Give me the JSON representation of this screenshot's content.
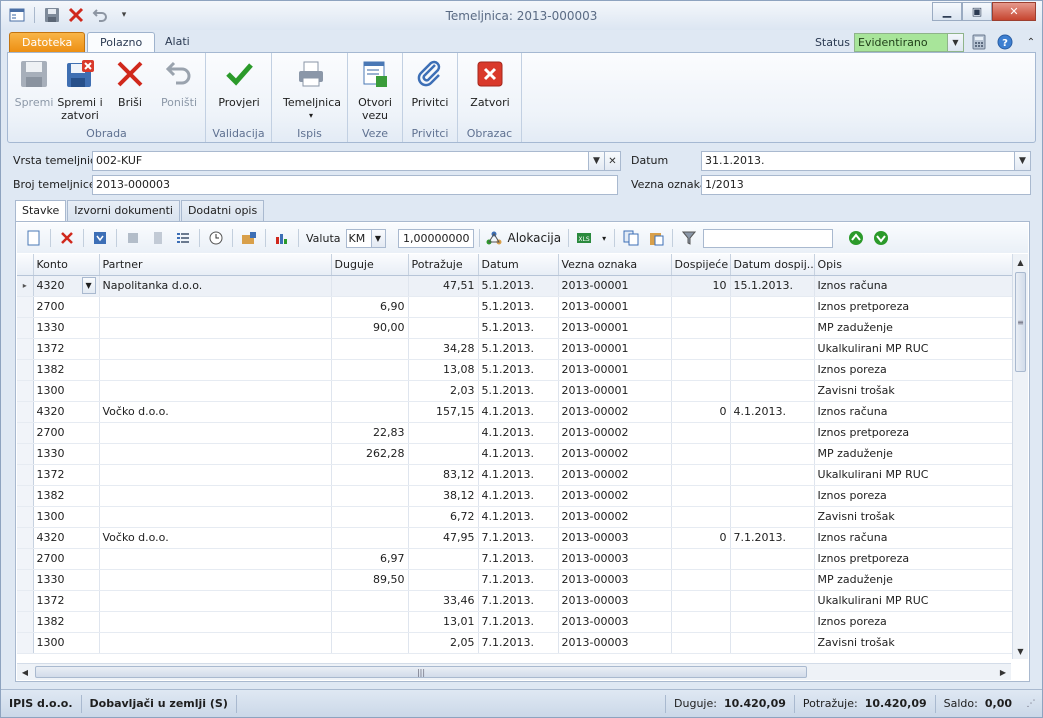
{
  "window": {
    "title": "Temeljnica: 2013-000003"
  },
  "ribbon_tabs": {
    "file": "Datoteka",
    "home": "Polazno",
    "tools": "Alati"
  },
  "status": {
    "label": "Status",
    "value": "Evidentirano"
  },
  "ribbon": {
    "groups": {
      "obrada": "Obrada",
      "validacija": "Validacija",
      "ispis": "Ispis",
      "veze": "Veze",
      "privitci": "Privitci",
      "obrazac": "Obrazac"
    },
    "buttons": {
      "spremi": "Spremi",
      "spremi_zatvori_1": "Spremi i",
      "spremi_zatvori_2": "zatvori",
      "brisi": "Briši",
      "ponisti": "Poništi",
      "provjeri": "Provjeri",
      "temeljnica": "Temeljnica",
      "otvori_vezu_1": "Otvori",
      "otvori_vezu_2": "vezu",
      "privitci": "Privitci",
      "zatvori": "Zatvori"
    }
  },
  "header": {
    "vrsta_label": "Vrsta temeljnice",
    "vrsta_value": "002-KUF",
    "broj_label": "Broj temeljnice",
    "broj_value": "2013-000003",
    "datum_label": "Datum",
    "datum_value": "31.1.2013.",
    "vezna_label": "Vezna oznaka",
    "vezna_value": "1/2013"
  },
  "content_tabs": [
    "Stavke",
    "Izvorni dokumenti",
    "Dodatni opis"
  ],
  "grid_toolbar": {
    "valuta_label": "Valuta",
    "valuta_value": "KM",
    "tecaj_value": "1,00000000",
    "alokacija_label": "Alokacija",
    "filter_value": ""
  },
  "grid": {
    "columns": [
      "Konto",
      "Partner",
      "Duguje",
      "Potražuje",
      "Datum",
      "Vezna oznaka",
      "Dospijeće",
      "Datum dospij...",
      "Opis"
    ],
    "rows": [
      [
        "4320",
        "Napolitanka d.o.o.",
        "",
        "47,51",
        "5.1.2013.",
        "2013-00001",
        "10",
        "15.1.2013.",
        "Iznos računa"
      ],
      [
        "2700",
        "",
        "6,90",
        "",
        "5.1.2013.",
        "2013-00001",
        "",
        "",
        "Iznos pretporeza"
      ],
      [
        "1330",
        "",
        "90,00",
        "",
        "5.1.2013.",
        "2013-00001",
        "",
        "",
        "MP zaduženje"
      ],
      [
        "1372",
        "",
        "",
        "34,28",
        "5.1.2013.",
        "2013-00001",
        "",
        "",
        "Ukalkulirani MP RUC"
      ],
      [
        "1382",
        "",
        "",
        "13,08",
        "5.1.2013.",
        "2013-00001",
        "",
        "",
        "Iznos poreza"
      ],
      [
        "1300",
        "",
        "",
        "2,03",
        "5.1.2013.",
        "2013-00001",
        "",
        "",
        "Zavisni trošak"
      ],
      [
        "4320",
        "Vočko d.o.o.",
        "",
        "157,15",
        "4.1.2013.",
        "2013-00002",
        "0",
        "4.1.2013.",
        "Iznos računa"
      ],
      [
        "2700",
        "",
        "22,83",
        "",
        "4.1.2013.",
        "2013-00002",
        "",
        "",
        "Iznos pretporeza"
      ],
      [
        "1330",
        "",
        "262,28",
        "",
        "4.1.2013.",
        "2013-00002",
        "",
        "",
        "MP zaduženje"
      ],
      [
        "1372",
        "",
        "",
        "83,12",
        "4.1.2013.",
        "2013-00002",
        "",
        "",
        "Ukalkulirani MP RUC"
      ],
      [
        "1382",
        "",
        "",
        "38,12",
        "4.1.2013.",
        "2013-00002",
        "",
        "",
        "Iznos poreza"
      ],
      [
        "1300",
        "",
        "",
        "6,72",
        "4.1.2013.",
        "2013-00002",
        "",
        "",
        "Zavisni trošak"
      ],
      [
        "4320",
        "Vočko d.o.o.",
        "",
        "47,95",
        "7.1.2013.",
        "2013-00003",
        "0",
        "7.1.2013.",
        "Iznos računa"
      ],
      [
        "2700",
        "",
        "6,97",
        "",
        "7.1.2013.",
        "2013-00003",
        "",
        "",
        "Iznos pretporeza"
      ],
      [
        "1330",
        "",
        "89,50",
        "",
        "7.1.2013.",
        "2013-00003",
        "",
        "",
        "MP zaduženje"
      ],
      [
        "1372",
        "",
        "",
        "33,46",
        "7.1.2013.",
        "2013-00003",
        "",
        "",
        "Ukalkulirani MP RUC"
      ],
      [
        "1382",
        "",
        "",
        "13,01",
        "7.1.2013.",
        "2013-00003",
        "",
        "",
        "Iznos poreza"
      ],
      [
        "1300",
        "",
        "",
        "2,05",
        "7.1.2013.",
        "2013-00003",
        "",
        "",
        "Zavisni trošak"
      ]
    ]
  },
  "statusbar": {
    "company": "IPIS d.o.o.",
    "journal": "Dobavljači u zemlji (S)",
    "duguje_label": "Duguje:",
    "duguje_value": "10.420,09",
    "potrazuje_label": "Potražuje:",
    "potrazuje_value": "10.420,09",
    "saldo_label": "Saldo:",
    "saldo_value": "0,00"
  },
  "colors": {
    "status_green": "#a8e59a",
    "file_tab": "#ec8d10",
    "close_red": "#d9392b"
  }
}
